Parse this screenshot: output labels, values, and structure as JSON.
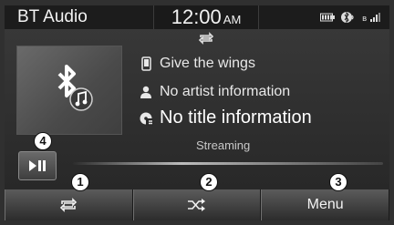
{
  "status_bar": {
    "source": "BT Audio",
    "time": "12:00",
    "ampm": "AM",
    "icons": [
      "battery-icon",
      "bluetooth-phone-icon",
      "signal-icon"
    ]
  },
  "track": {
    "song": "Give the wings",
    "artist": "No artist information",
    "title": "No title information",
    "streaming": "Streaming"
  },
  "buttons": {
    "menu_label": "Menu"
  },
  "callouts": [
    "1",
    "2",
    "3",
    "4"
  ],
  "colors": {
    "background": "#303030",
    "status_bar": "#1c1c1c",
    "text": "#f2f2f2"
  }
}
